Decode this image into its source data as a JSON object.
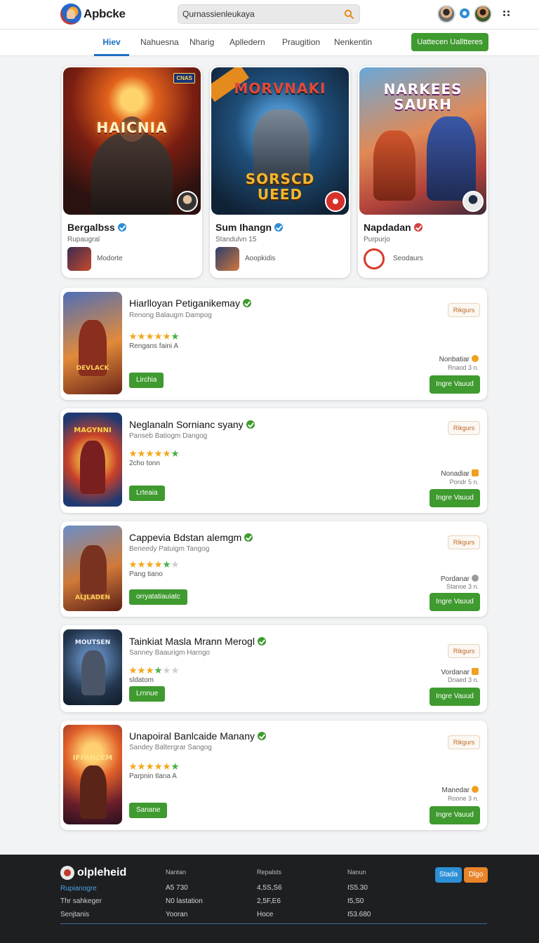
{
  "header": {
    "logo_text": "Apbcke",
    "search_placeholder": "Qurnassienleukaya"
  },
  "nav": {
    "tabs": [
      "Hiev",
      "Nahuesna",
      "Nharig",
      "Aplledern",
      "Praugition",
      "Nenkentin"
    ],
    "active_tab": "Hiev",
    "update_button": "Uattecen Ualltteres"
  },
  "featured": [
    {
      "art_title": "HAICNIA",
      "corner_badge": "CNAS",
      "name": "Bergalbss",
      "sub": "Rupaugral",
      "developer": "Modorte",
      "verify_color": "#2d8fd6"
    },
    {
      "art_title": "MORVNAKI",
      "art_subtitle": "SORSCD\nUEED",
      "corner_badge": "",
      "name": "Sum Ihangn",
      "sub": "Standulvn 15",
      "developer": "Aoopkidis",
      "verify_color": "#2d8fd6"
    },
    {
      "art_title": "NARKEES\nSAURH",
      "corner_badge": "",
      "name": "Napdadan",
      "sub": "Purpurjo",
      "developer": "Seodaurs",
      "verify_color": "#d64040"
    }
  ],
  "apps": [
    {
      "name": "Hiarlloyan Petiganikemay",
      "sub": "Renong Balaugm Dampog",
      "stars": 5,
      "extra": "Rengans faini A",
      "green_label": "Lirchia",
      "pill": "Rikgurs",
      "meta1": "Nonbatiar",
      "meta2": "Rnaod 3 n.",
      "download": "Ingre Vauud",
      "thumb_title": "DEVLACK"
    },
    {
      "name": "Neglanaln Sornianc syany",
      "sub": "Panseb Batiogm Dangog",
      "stars": 5,
      "extra": "2cho tonn",
      "green_label": "Lrteaia",
      "pill": "Rikgurs",
      "meta1": "Nonadiar",
      "meta2": "Pondr 5 n.",
      "download": "Ingre Vauud",
      "thumb_title": "MAGYNNI"
    },
    {
      "name": "Cappevia Bdstan alemgm",
      "sub": "Beneedy Patuigm Tangog",
      "stars": 4,
      "extra": "Pang tiano",
      "green_label": "orryatatiauiatc",
      "pill": "Rikgurs",
      "meta1": "Pordanar",
      "meta2": "Stanoe 3 n.",
      "download": "Ingre Vauud",
      "thumb_title": "ALJLADEN"
    },
    {
      "name": "Tainkiat Masla Mrann Merogl",
      "sub": "Sanney Baaurigm Harngo",
      "stars": 3,
      "extra": "sldatom",
      "green_label": "Lrnnue",
      "pill": "Rikgurs",
      "meta1": "Vordanar",
      "meta2": "Dnaed 3 n.",
      "download": "Ingre Vauud",
      "thumb_title": "MOUTSEN"
    },
    {
      "name": "Unapoiral Banlcaide Manany",
      "sub": "Sandey Baltergrar Sangog",
      "stars": 5,
      "extra": "Parpnin tlana A",
      "green_label": "Sanane",
      "pill": "Rikgurs",
      "meta1": "Manedar",
      "meta2": "Roone 3 n.",
      "download": "Ingre Vauud",
      "thumb_title": "IFFANCEM"
    }
  ],
  "footer": {
    "brand": "olpleheid",
    "links": [
      "Rupianogre",
      "Thr sahkeger",
      "Senjtanis"
    ],
    "columns": [
      {
        "head": "Nantan",
        "rows": [
          "A5 730",
          "N0 lastation",
          "Yooran"
        ]
      },
      {
        "head": "Repalsts",
        "rows": [
          "4,5S,S6",
          "2,5F,E6",
          "Hoce"
        ]
      },
      {
        "head": "Nanun",
        "rows": [
          "IS5.30",
          "I5,S0",
          "I53.680"
        ]
      }
    ],
    "btn_blue": "Stada",
    "btn_orange": "Dlgo"
  },
  "colors": {
    "accent_green": "#3f9a2f",
    "accent_blue": "#1a6fc2",
    "footer_bg": "#1e1f21"
  }
}
